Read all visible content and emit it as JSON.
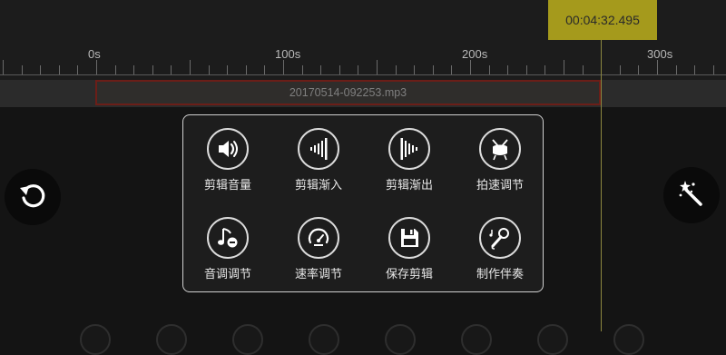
{
  "timeline": {
    "current_time": "00:04:32.495",
    "ruler_labels": [
      "0s",
      "100s",
      "200s",
      "300s"
    ],
    "clip_name": "20170514-092253.mp3"
  },
  "left_button": {
    "icon": "undo-icon"
  },
  "right_button": {
    "icon": "magic-wand-icon"
  },
  "menu": {
    "items": [
      {
        "label": "剪辑音量",
        "icon": "volume-icon"
      },
      {
        "label": "剪辑渐入",
        "icon": "fade-in-icon"
      },
      {
        "label": "剪辑渐出",
        "icon": "fade-out-icon"
      },
      {
        "label": "拍速调节",
        "icon": "drum-icon"
      },
      {
        "label": "音调调节",
        "icon": "pitch-icon"
      },
      {
        "label": "速率调节",
        "icon": "speedometer-icon"
      },
      {
        "label": "保存剪辑",
        "icon": "save-icon"
      },
      {
        "label": "制作伴奏",
        "icon": "microphone-icon"
      }
    ]
  },
  "colors": {
    "playhead_badge": "#a59a1c",
    "clip_border": "#6b1e18",
    "panel_border": "#cfcfcf"
  }
}
